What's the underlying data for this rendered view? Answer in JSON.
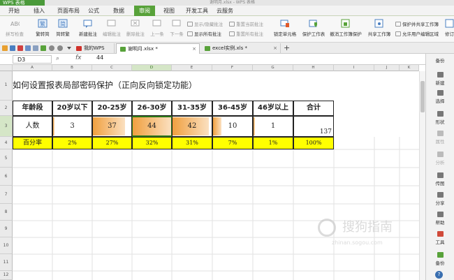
{
  "app": {
    "logo": "WPS 表格",
    "window_title": "谢明月.xlsx - WPS 表格"
  },
  "menu": [
    "开始",
    "插入",
    "页面布局",
    "公式",
    "数据",
    "审阅",
    "视图",
    "开发工具",
    "云服务"
  ],
  "menu_active": "审阅",
  "ribbon": {
    "spell": "拼写检查",
    "trad_to_simp": "繁转简",
    "simp_to_trad": "简转繁",
    "new_comment": "新建批注",
    "edit_comment": "编辑批注",
    "delete_comment": "删除批注",
    "prev": "上一条",
    "next": "下一条",
    "show_hide_comment": "显示/隐藏批注",
    "reset_current_comment": "重置当前批注",
    "show_all_comments": "显示所有批注",
    "reset_all_comments": "重置所有批注",
    "lock_cell": "锁定单元格",
    "protect_sheet": "保护工作表",
    "unprotect_workbook": "撤消工作簿保护",
    "share_workbook": "共享工作簿",
    "protect_share_workbook": "保护并共享工作簿",
    "allow_edit_ranges": "允许用户编辑区域",
    "track_changes": "修订"
  },
  "tabs": [
    {
      "label": "我的WPS",
      "closable": false
    },
    {
      "label": "谢明月.xlsx *",
      "closable": true
    },
    {
      "label": "excel实例.xls *",
      "closable": true
    }
  ],
  "tab_add": "+",
  "formula": {
    "cell_ref": "D3",
    "fx": "fx",
    "value": "44"
  },
  "columns": [
    "A",
    "B",
    "C",
    "D",
    "E",
    "F",
    "G",
    "H",
    "I",
    "J",
    "K"
  ],
  "selected_column": "D",
  "rows": [
    "1",
    "2",
    "3",
    "4",
    "5",
    "6",
    "7",
    "8",
    "9",
    "10",
    "11",
    "12"
  ],
  "sheet": {
    "title": "如何设置报表局部密码保护（正向反向锁定功能）",
    "header": [
      "年龄段",
      "20岁以下",
      "20-25岁",
      "26-30岁",
      "31-35岁",
      "36-45岁",
      "46岁以上",
      "合计"
    ],
    "row_count": [
      "人数",
      "3",
      "37",
      "44",
      "42",
      "10",
      "1",
      "137"
    ],
    "row_pct": [
      "百分率",
      "2%",
      "27%",
      "32%",
      "31%",
      "7%",
      "1%",
      "100%"
    ]
  },
  "sidebar": [
    "新建",
    "选择",
    "形状",
    "属性",
    "分析",
    "传图",
    "分享",
    "帮助",
    "工具",
    "备份"
  ],
  "sidebar_top": "备份",
  "watermark": {
    "line1": "搜狗指南",
    "line2": "zhinan.sogou.com"
  },
  "colors": {
    "accent_green": "#58a23a",
    "yellow_fill": "#ffff00",
    "bar_orange": "#f0a040"
  }
}
